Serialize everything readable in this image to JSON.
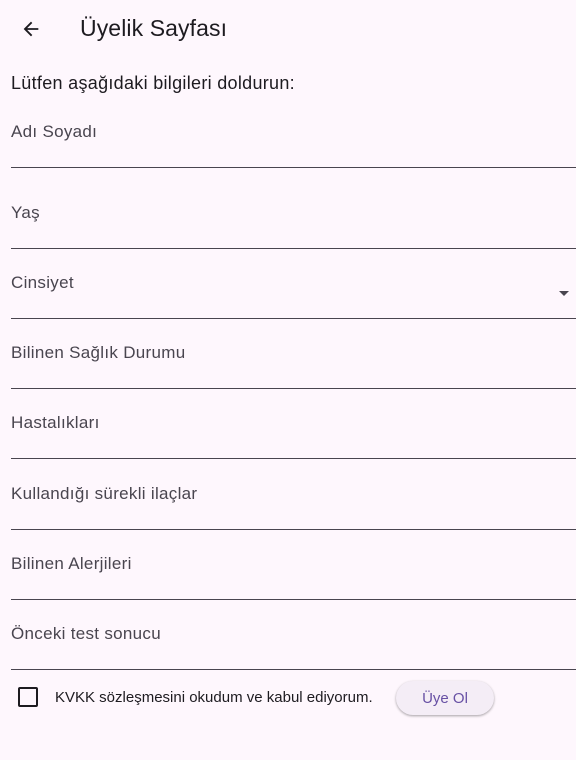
{
  "appbar": {
    "title": "Üyelik Sayfası",
    "back_icon": "arrow-left-icon"
  },
  "intro_text": "Lütfen aşağıdaki bilgileri doldurun:",
  "fields": [
    {
      "label": "Adı Soyadı",
      "value": ""
    },
    {
      "label": "Yaş",
      "value": ""
    },
    {
      "label": "Cinsiyet",
      "value": ""
    },
    {
      "label": "Bilinen Sağlık Durumu",
      "value": ""
    },
    {
      "label": "Hastalıkları",
      "value": ""
    },
    {
      "label": "Kullandığı sürekli ilaçlar",
      "value": ""
    },
    {
      "label": "Bilinen Alerjileri",
      "value": ""
    },
    {
      "label": "Önceki test sonucu",
      "value": ""
    }
  ],
  "consent": {
    "label": "KVKK sözleşmesini okudum ve kabul ediyorum.",
    "checked": false
  },
  "register_button": "Üye Ol",
  "colors": {
    "background": "#fef7fd",
    "accent": "#6750a4",
    "text": "#1d1b20",
    "underline": "#49454f"
  }
}
